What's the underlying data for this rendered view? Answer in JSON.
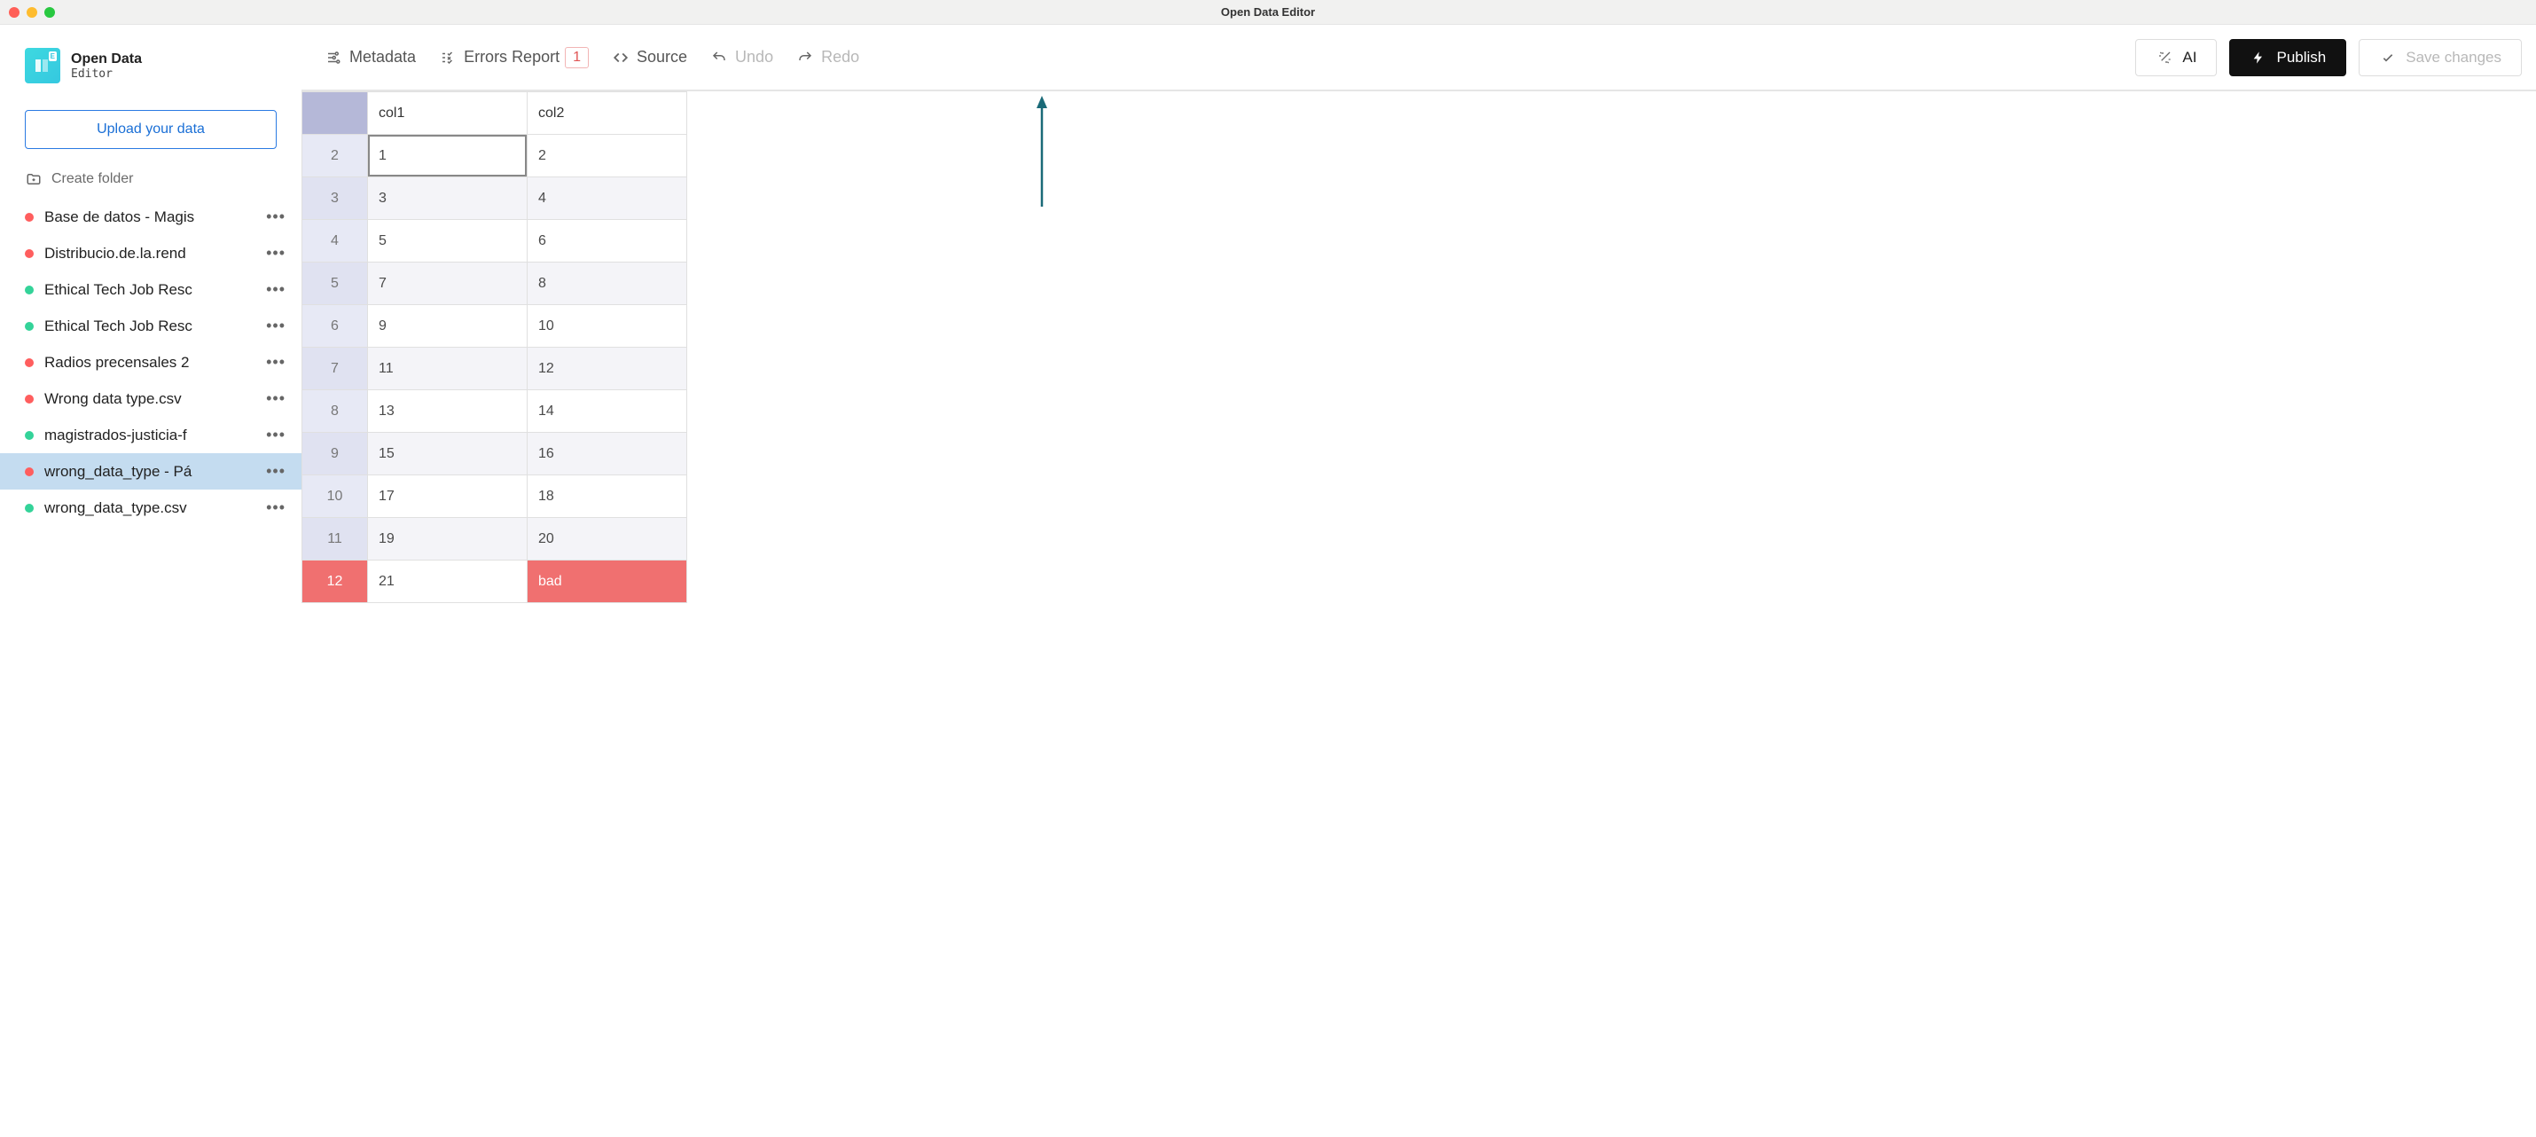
{
  "titlebar": {
    "title": "Open Data Editor"
  },
  "brand": {
    "name": "Open Data",
    "sub": "Editor"
  },
  "sidebar": {
    "upload_label": "Upload your data",
    "create_folder_label": "Create folder",
    "files": [
      {
        "name": "Base de datos - Magis",
        "status": "red",
        "active": false
      },
      {
        "name": "Distribucio.de.la.rend",
        "status": "red",
        "active": false
      },
      {
        "name": "Ethical Tech Job Resc",
        "status": "green",
        "active": false
      },
      {
        "name": "Ethical Tech Job Resc",
        "status": "green",
        "active": false
      },
      {
        "name": "Radios precensales 2",
        "status": "red",
        "active": false
      },
      {
        "name": "Wrong data type.csv",
        "status": "red",
        "active": false
      },
      {
        "name": "magistrados-justicia-f",
        "status": "green",
        "active": false
      },
      {
        "name": "wrong_data_type - Pá",
        "status": "red",
        "active": true
      },
      {
        "name": "wrong_data_type.csv",
        "status": "green",
        "active": false
      }
    ]
  },
  "toolbar": {
    "metadata_label": "Metadata",
    "errors_label": "Errors Report",
    "errors_count": "1",
    "source_label": "Source",
    "undo_label": "Undo",
    "redo_label": "Redo",
    "ai_label": "AI",
    "publish_label": "Publish",
    "save_label": "Save changes"
  },
  "table": {
    "columns": [
      "col1",
      "col2"
    ],
    "rows": [
      {
        "num": "2",
        "cells": [
          "1",
          "2"
        ],
        "selected": 0
      },
      {
        "num": "3",
        "cells": [
          "3",
          "4"
        ]
      },
      {
        "num": "4",
        "cells": [
          "5",
          "6"
        ]
      },
      {
        "num": "5",
        "cells": [
          "7",
          "8"
        ]
      },
      {
        "num": "6",
        "cells": [
          "9",
          "10"
        ]
      },
      {
        "num": "7",
        "cells": [
          "11",
          "12"
        ]
      },
      {
        "num": "8",
        "cells": [
          "13",
          "14"
        ]
      },
      {
        "num": "9",
        "cells": [
          "15",
          "16"
        ]
      },
      {
        "num": "10",
        "cells": [
          "17",
          "18"
        ]
      },
      {
        "num": "11",
        "cells": [
          "19",
          "20"
        ]
      },
      {
        "num": "12",
        "cells": [
          "21",
          "bad"
        ],
        "error": true,
        "error_cell": 1
      }
    ]
  },
  "colors": {
    "accent": "#1a6fd6",
    "error": "#f07070",
    "annotation": "#1a6a78"
  }
}
